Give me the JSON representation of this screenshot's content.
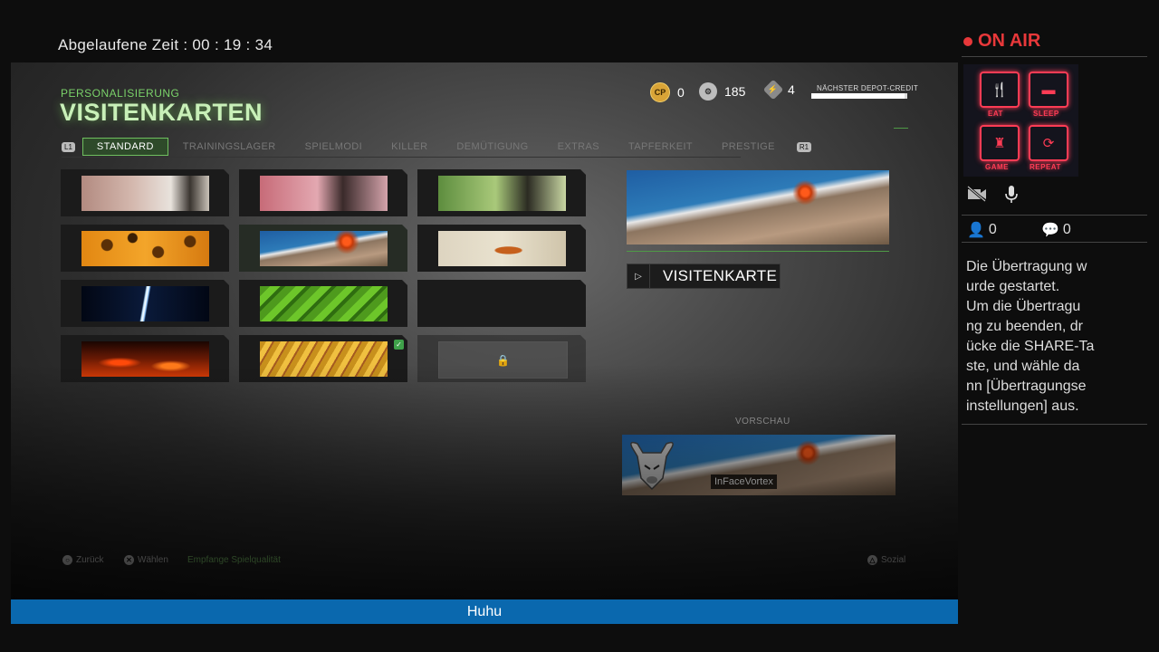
{
  "elapsed": {
    "label": "Abgelaufene Zeit :",
    "value": "00 : 19 : 34"
  },
  "header": {
    "section": "PERSONALISIERUNG",
    "title": "VISITENKARTEN"
  },
  "currencies": [
    {
      "icon": "cp-coin-icon",
      "glyph": "CP",
      "value": "0"
    },
    {
      "icon": "gear-icon",
      "glyph": "⚙",
      "value": "185"
    },
    {
      "icon": "bolt-icon",
      "glyph": "⚡",
      "value": "4"
    }
  ],
  "depot": {
    "label": "NÄCHSTER DEPOT-CREDIT",
    "progress": 0.97
  },
  "tabs": {
    "left_button": "L1",
    "right_button": "R1",
    "items": [
      "STANDARD",
      "TRAININGSLAGER",
      "SPIELMODI",
      "KILLER",
      "DEMÜTIGUNG",
      "EXTRAS",
      "TAPFERKEIT",
      "PRESTIGE"
    ],
    "active": "STANDARD"
  },
  "cards": [
    {
      "name": "card-soldier-pink",
      "theme": "t-soldier1",
      "selected": false,
      "equipped": false,
      "locked": false
    },
    {
      "name": "card-soldier-red",
      "theme": "t-soldier2",
      "selected": false,
      "equipped": false,
      "locked": false
    },
    {
      "name": "card-soldier-green",
      "theme": "t-soldier3",
      "selected": false,
      "equipped": false,
      "locked": false
    },
    {
      "name": "card-leopard",
      "theme": "t-leo",
      "selected": false,
      "equipped": false,
      "locked": false
    },
    {
      "name": "card-volcano",
      "theme": "t-volcano",
      "selected": true,
      "equipped": false,
      "locked": false
    },
    {
      "name": "card-squirrel",
      "theme": "t-squirrel",
      "selected": false,
      "equipped": false,
      "locked": false
    },
    {
      "name": "card-lightning",
      "theme": "t-lightning",
      "selected": false,
      "equipped": false,
      "locked": false
    },
    {
      "name": "card-green-scales",
      "theme": "t-green",
      "selected": false,
      "equipped": false,
      "locked": false
    },
    {
      "name": "card-gun",
      "theme": "t-gun",
      "selected": false,
      "equipped": false,
      "locked": false
    },
    {
      "name": "card-fire",
      "theme": "t-fire",
      "selected": false,
      "equipped": false,
      "locked": false
    },
    {
      "name": "card-gold",
      "theme": "t-gold",
      "selected": false,
      "equipped": true,
      "locked": false
    },
    {
      "name": "card-locked",
      "theme": "",
      "selected": false,
      "equipped": false,
      "locked": true
    }
  ],
  "detail": {
    "button_label": "VISITENKARTE"
  },
  "preview": {
    "label": "VORSCHAU",
    "player_name": "InFaceVortex"
  },
  "footer": {
    "back": {
      "icon": "circle-button-icon",
      "glyph": "○",
      "label": "Zurück"
    },
    "select": {
      "icon": "cross-button-icon",
      "glyph": "✕",
      "label": "Wählen"
    },
    "quality": "Empfange Spielqualität",
    "social": {
      "icon": "triangle-button-icon",
      "glyph": "△",
      "label": "Sozial"
    }
  },
  "ticker": "Huhu",
  "stream": {
    "on_air": "ON AIR",
    "logo_labels": [
      "EAT",
      "SLEEP",
      "GAME",
      "REPEAT"
    ],
    "viewers": "0",
    "comments": "0",
    "message_lines": [
      "Die Übertragung w",
      "urde gestartet.",
      "Um die Übertragu",
      "ng zu beenden, dr",
      "ücke die SHARE-Ta",
      "ste, und wähle da",
      "nn [Übertragungse",
      "instellungen] aus."
    ]
  },
  "colors": {
    "accent_green": "#56a34c",
    "ticker_blue": "#0a68ae",
    "on_air_red": "#e8383a",
    "neon_pink": "#ff3c55"
  }
}
